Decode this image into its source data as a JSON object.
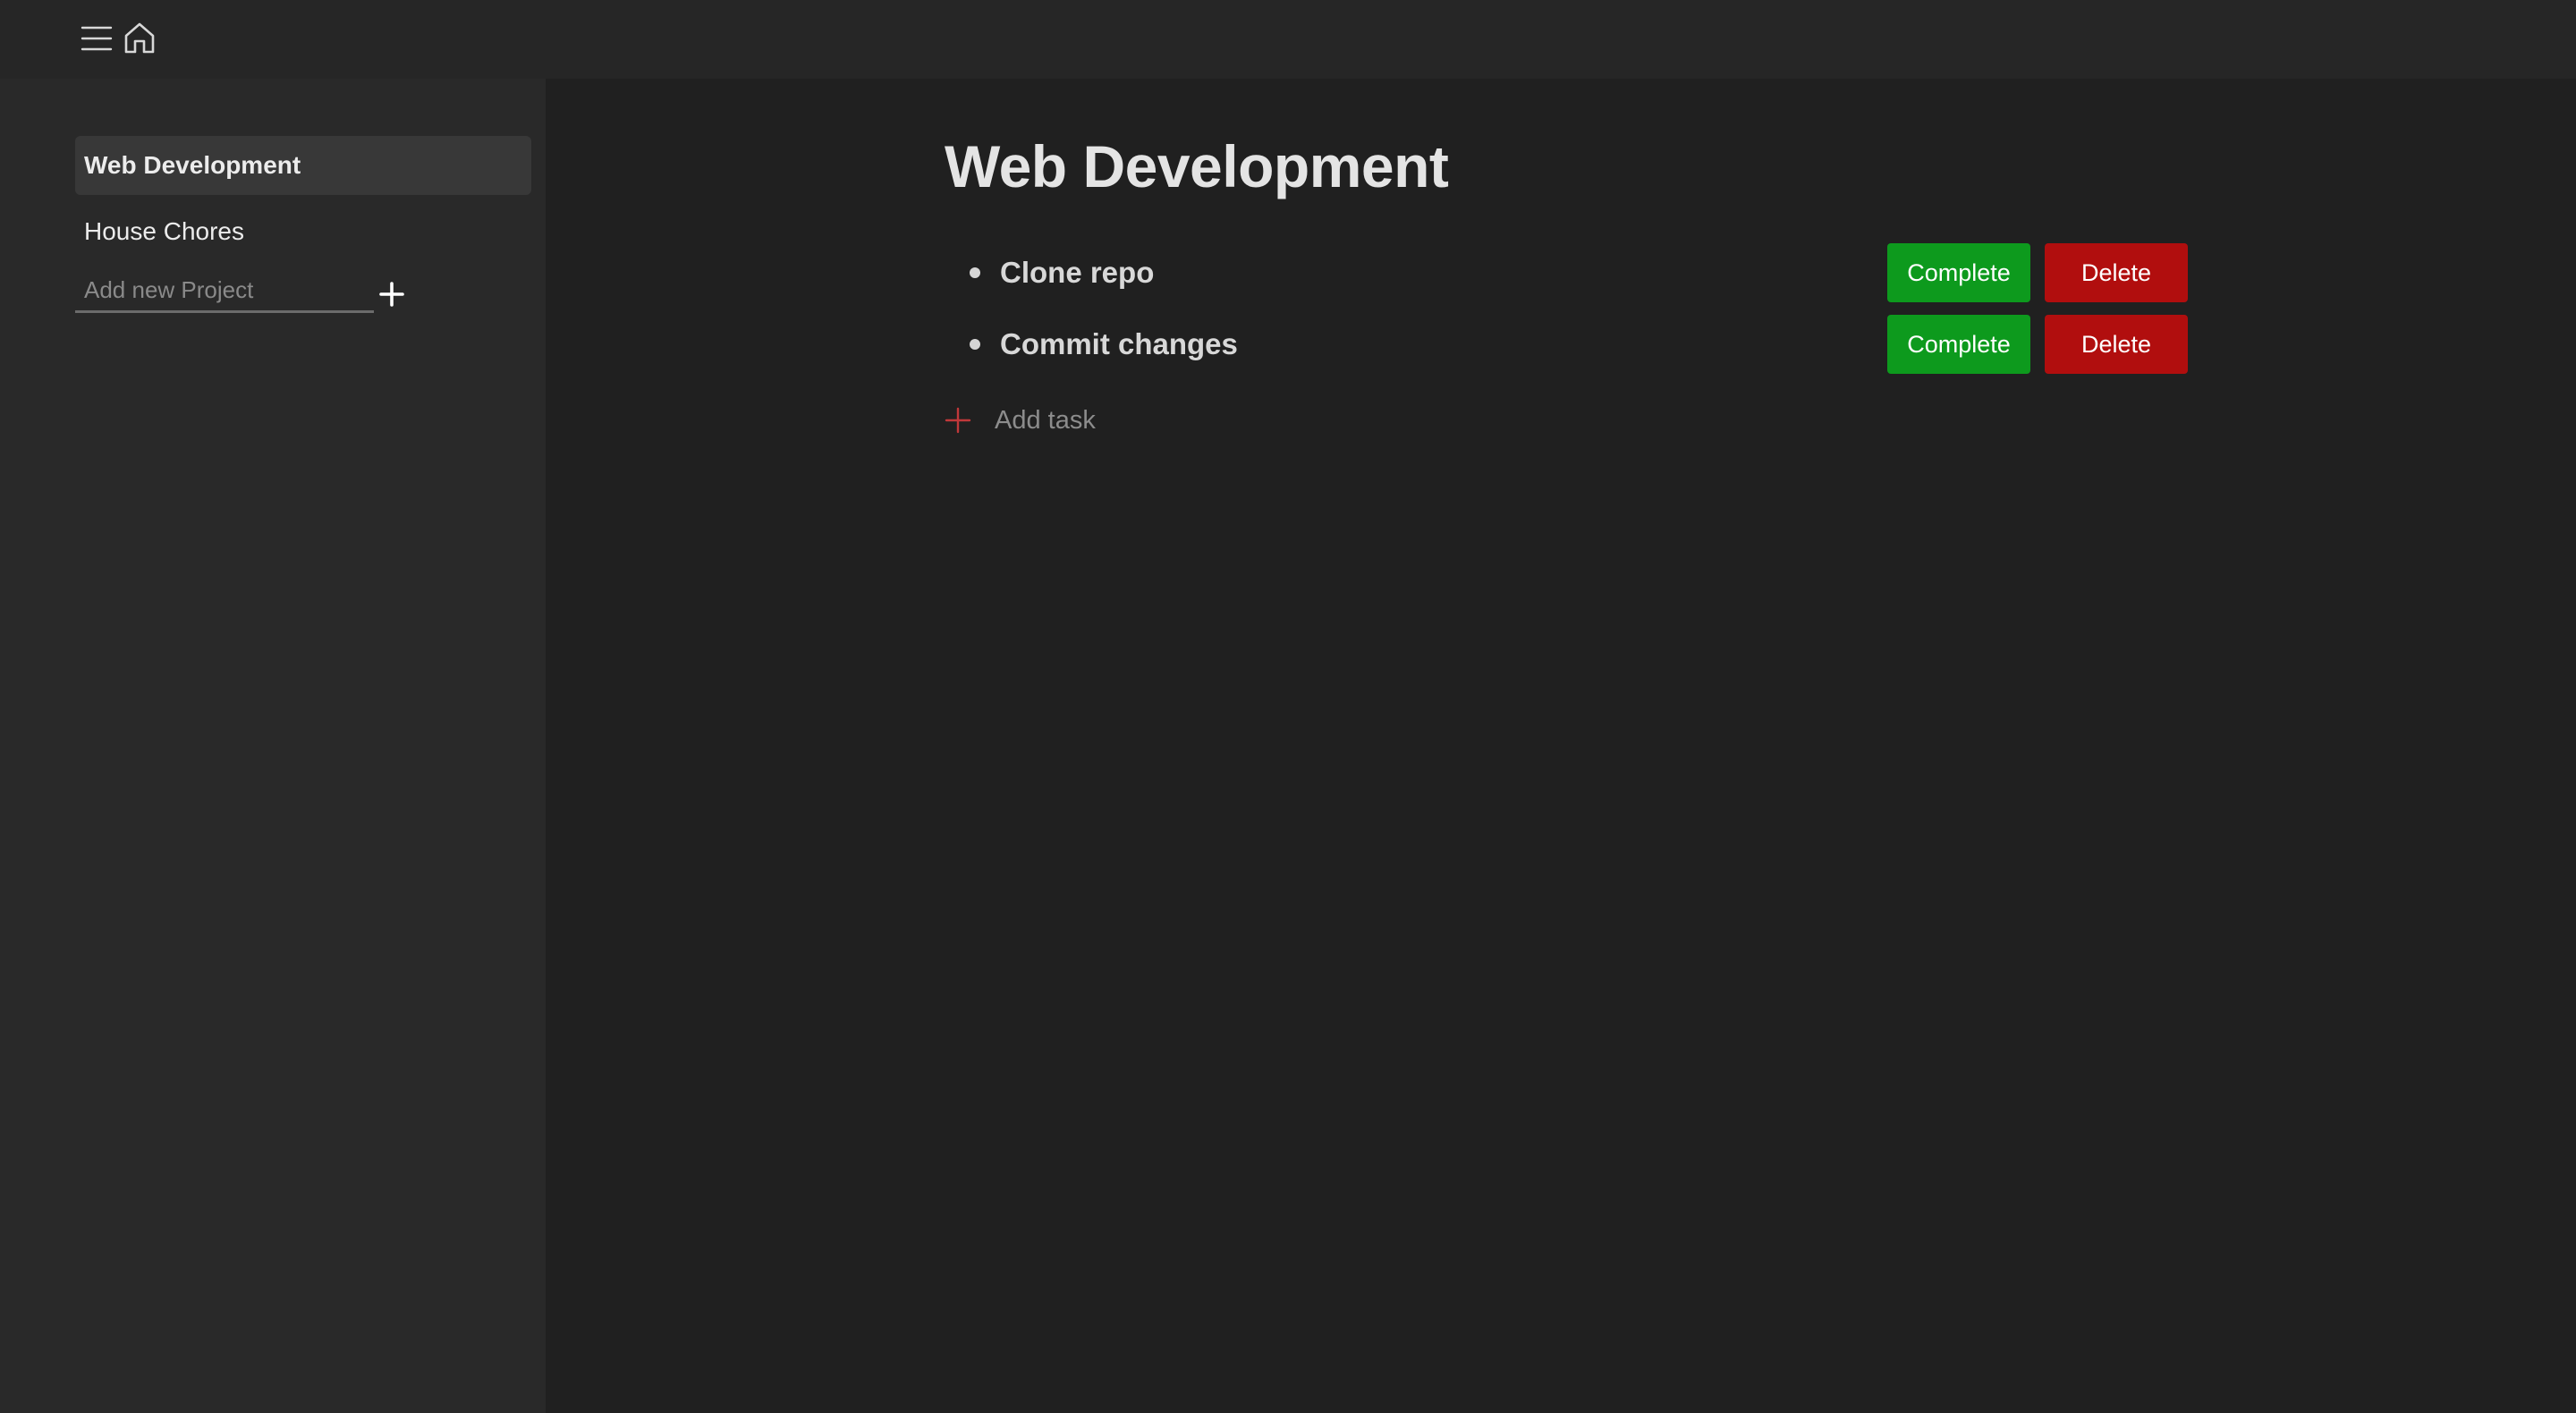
{
  "header": {
    "menu_icon": "hamburger-menu-icon",
    "home_icon": "home-icon"
  },
  "sidebar": {
    "projects": [
      {
        "label": "Web Development",
        "active": true
      },
      {
        "label": "House Chores",
        "active": false
      }
    ],
    "new_project": {
      "value": "",
      "placeholder": "Add new Project",
      "add_icon": "plus-icon"
    }
  },
  "main": {
    "title": "Web Development",
    "tasks": [
      {
        "label": "Clone repo",
        "complete_label": "Complete",
        "delete_label": "Delete"
      },
      {
        "label": "Commit changes",
        "complete_label": "Complete",
        "delete_label": "Delete"
      }
    ],
    "add_task": {
      "label": "Add task",
      "icon": "plus-icon"
    }
  },
  "colors": {
    "background": "#202020",
    "sidebar": "#292929",
    "topbar": "#262626",
    "complete": "#0d9a1d",
    "delete": "#b10e0e",
    "add_task_accent": "#c0383a"
  }
}
